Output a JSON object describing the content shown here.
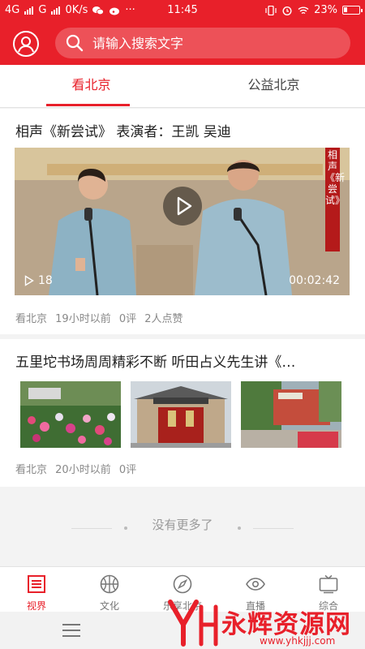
{
  "status_bar": {
    "network_1": "4G",
    "network_2": "G",
    "speed": "0K/s",
    "more": "···",
    "time": "11:45",
    "battery": "23%",
    "battery_level": 0.23,
    "icons": [
      "signal-icon",
      "signal-icon",
      "wechat-icon",
      "weibo-icon",
      "vibrate-icon",
      "alarm-icon",
      "wifi-icon",
      "battery-icon"
    ]
  },
  "header": {
    "avatar_icon": "user-icon",
    "search_placeholder": "请输入搜索文字",
    "search_icon": "search-icon",
    "brand_color": "#e8202a"
  },
  "tabs": [
    {
      "label": "看北京",
      "active": true
    },
    {
      "label": "公益北京",
      "active": false
    }
  ],
  "feed": [
    {
      "title": "相声《新尝试》 表演者：王凯 吴迪",
      "type": "video",
      "play_count": "18",
      "duration": "00:02:42",
      "banner_text": "相声《新尝试》",
      "source": "看北京",
      "time": "19小时以前",
      "comments": "0评",
      "likes": "2人点赞"
    },
    {
      "title": "五里坨书场周周精彩不断 听田占义先生讲《…",
      "type": "gallery",
      "image_count": 3,
      "source": "看北京",
      "time": "20小时以前",
      "comments": "0评"
    }
  ],
  "no_more": "没有更多了",
  "bottom_nav": [
    {
      "label": "视界",
      "icon": "news-icon",
      "active": true
    },
    {
      "label": "文化",
      "icon": "basketball-icon",
      "active": false
    },
    {
      "label": "乐享北京",
      "icon": "compass-icon",
      "active": false
    },
    {
      "label": "直播",
      "icon": "eye-icon",
      "active": false
    },
    {
      "label": "综合",
      "icon": "tv-icon",
      "active": false
    }
  ],
  "watermark": {
    "text": "永辉资源网",
    "url": "www.yhkjjj.com"
  }
}
